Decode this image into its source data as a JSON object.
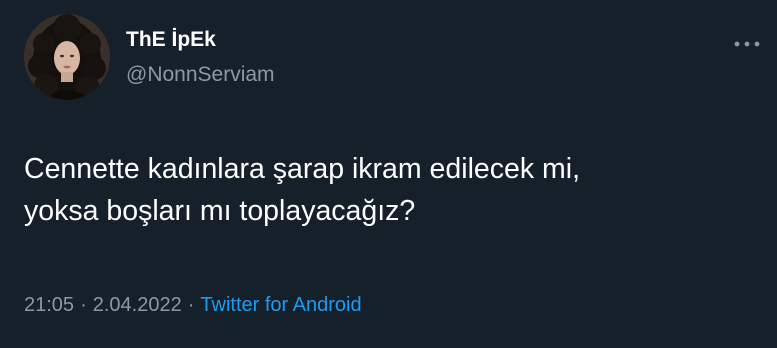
{
  "tweet": {
    "author": {
      "display_name": "ThE İpEk",
      "handle": "@NonnServiam"
    },
    "text_lines": [
      "Cennette kadınlara şarap ikram edilecek mi,",
      "yoksa boşları mı toplayacağız?"
    ],
    "meta": {
      "time": "21:05",
      "separator": "·",
      "date": "2.04.2022",
      "source": "Twitter for Android"
    },
    "more_icon": "more-horizontal-icon"
  },
  "colors": {
    "background": "#15202b",
    "primary_text": "#ffffff",
    "secondary_text": "#8b98a5",
    "link": "#1d9bf0"
  }
}
